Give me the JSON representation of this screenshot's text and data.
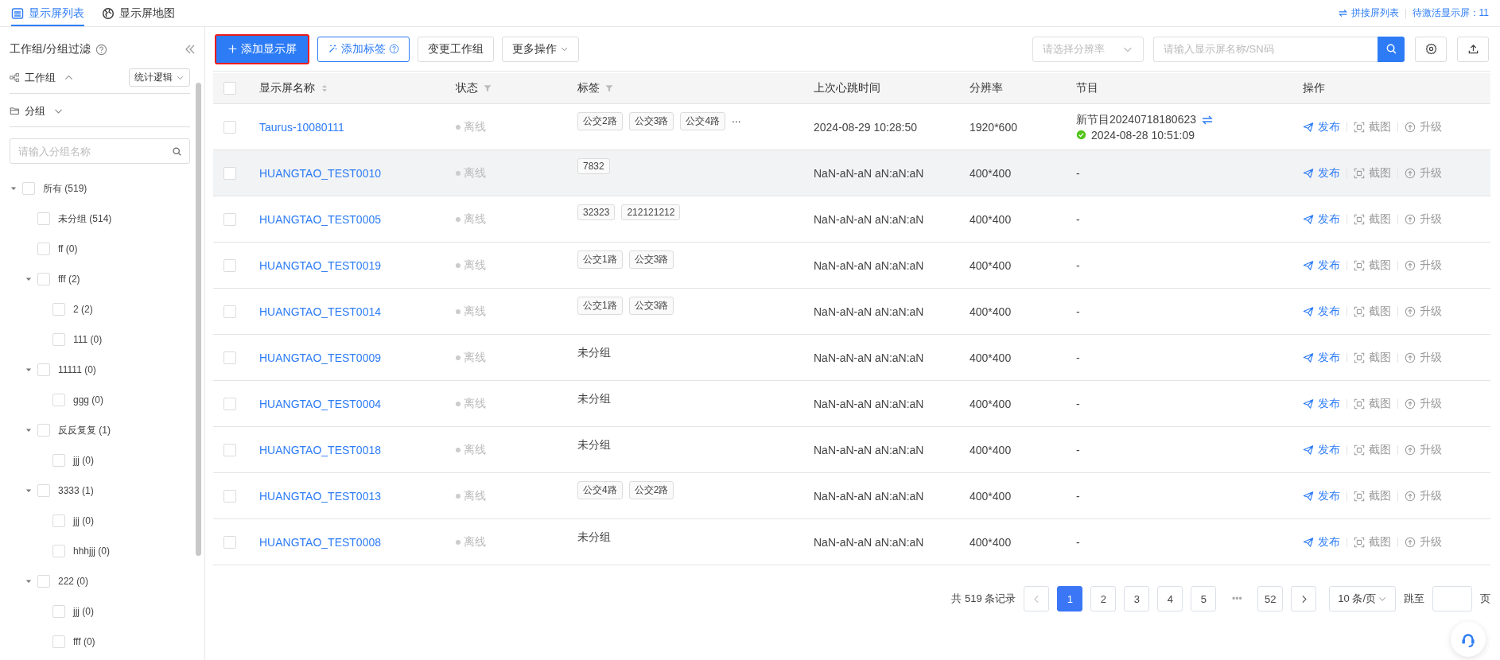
{
  "top_tabs": [
    {
      "label": "显示屏列表",
      "selected": true
    },
    {
      "label": "显示屏地图",
      "selected": false
    }
  ],
  "top_links": {
    "splice": "拼接屏列表",
    "pending": "待激活显示屏：11"
  },
  "sidebar": {
    "title": "工作组/分组过滤",
    "workgroup": {
      "label": "工作组",
      "expanded": true,
      "logic": "统计逻辑"
    },
    "group": {
      "label": "分组",
      "expanded": false
    },
    "search": {
      "placeholder": "请输入分组名称"
    },
    "tree": [
      {
        "label": "所有 (519)",
        "checked": false,
        "expanded": true,
        "children": [
          {
            "label": "未分组 (514)",
            "checked": false
          },
          {
            "label": "ff (0)",
            "checked": false
          },
          {
            "label": "fff (2)",
            "checked": false,
            "expanded": true,
            "children": [
              {
                "label": "2 (2)",
                "checked": false
              },
              {
                "label": "111 (0)",
                "checked": false
              }
            ]
          },
          {
            "label": "11111 (0)",
            "checked": false,
            "expanded": true,
            "children": [
              {
                "label": "ggg (0)",
                "checked": false
              }
            ]
          },
          {
            "label": "反反复复 (1)",
            "checked": false,
            "expanded": true,
            "children": [
              {
                "label": "jjj (0)",
                "checked": false
              }
            ]
          },
          {
            "label": "3333 (1)",
            "checked": false,
            "expanded": true,
            "children": [
              {
                "label": "jjj (0)",
                "checked": false
              },
              {
                "label": "hhhjjj (0)",
                "checked": false
              }
            ]
          },
          {
            "label": "222 (0)",
            "checked": false,
            "expanded": true,
            "children": [
              {
                "label": "jjj (0)",
                "checked": false
              },
              {
                "label": "fff (0)",
                "checked": false
              }
            ]
          }
        ]
      }
    ]
  },
  "toolbar": {
    "buttons": [
      {
        "label": "添加显示屏",
        "kind": "primary"
      },
      {
        "label": "添加标签",
        "kind": "tag"
      },
      {
        "label": "变更工作组",
        "kind": "plain"
      },
      {
        "label": "更多操作",
        "kind": "dropdown"
      }
    ],
    "resolution": {
      "placeholder": "请选择分辨率"
    },
    "search": {
      "placeholder": "请输入显示屏名称/SN码"
    }
  },
  "table": {
    "select_all": {
      "checked": false
    },
    "columns": [
      {
        "label": "显示屏名称",
        "sort": true
      },
      {
        "label": "状态",
        "filter": true
      },
      {
        "label": "标签",
        "filter": true
      },
      {
        "label": "上次心跳时间"
      },
      {
        "label": "分辨率"
      },
      {
        "label": "节目"
      },
      {
        "label": "操作"
      }
    ],
    "rows": [
      {
        "checked": false,
        "hovered": false,
        "name": "Taurus-10080111",
        "status": {
          "label": "离线",
          "kind": "offline"
        },
        "tags": {
          "kind": "tags",
          "items": [
            "公交2路",
            "公交3路",
            "公交4路"
          ],
          "more": "..."
        },
        "heartbeat": "2024-08-29 10:28:50",
        "resolution": "1920*600",
        "program": {
          "kind": "program",
          "name": "新节目20240718180623",
          "time": "2024-08-28 10:51:09"
        },
        "actions": [
          {
            "label": "发布",
            "disabled": false
          },
          {
            "label": "截图",
            "disabled": true
          },
          {
            "label": "升级",
            "disabled": true
          }
        ]
      },
      {
        "checked": false,
        "hovered": true,
        "name": "HUANGTAO_TEST0010",
        "status": {
          "label": "离线",
          "kind": "offline"
        },
        "tags": {
          "kind": "tags",
          "items": [
            "7832"
          ]
        },
        "heartbeat": "NaN-aN-aN aN:aN:aN",
        "resolution": "400*400",
        "program": {
          "kind": "text",
          "text": "-"
        },
        "actions": [
          {
            "label": "发布",
            "disabled": false
          },
          {
            "label": "截图",
            "disabled": true
          },
          {
            "label": "升级",
            "disabled": true
          }
        ]
      },
      {
        "checked": false,
        "hovered": false,
        "name": "HUANGTAO_TEST0005",
        "status": {
          "label": "离线",
          "kind": "offline"
        },
        "tags": {
          "kind": "tags",
          "items": [
            "32323",
            "212121212"
          ]
        },
        "heartbeat": "NaN-aN-aN aN:aN:aN",
        "resolution": "400*400",
        "program": {
          "kind": "text",
          "text": "-"
        },
        "actions": [
          {
            "label": "发布",
            "disabled": false
          },
          {
            "label": "截图",
            "disabled": true
          },
          {
            "label": "升级",
            "disabled": true
          }
        ]
      },
      {
        "checked": false,
        "hovered": false,
        "name": "HUANGTAO_TEST0019",
        "status": {
          "label": "离线",
          "kind": "offline"
        },
        "tags": {
          "kind": "tags",
          "items": [
            "公交1路",
            "公交3路"
          ]
        },
        "heartbeat": "NaN-aN-aN aN:aN:aN",
        "resolution": "400*400",
        "program": {
          "kind": "text",
          "text": "-"
        },
        "actions": [
          {
            "label": "发布",
            "disabled": false
          },
          {
            "label": "截图",
            "disabled": true
          },
          {
            "label": "升级",
            "disabled": true
          }
        ]
      },
      {
        "checked": false,
        "hovered": false,
        "name": "HUANGTAO_TEST0014",
        "status": {
          "label": "离线",
          "kind": "offline"
        },
        "tags": {
          "kind": "tags",
          "items": [
            "公交1路",
            "公交3路"
          ]
        },
        "heartbeat": "NaN-aN-aN aN:aN:aN",
        "resolution": "400*400",
        "program": {
          "kind": "text",
          "text": "-"
        },
        "actions": [
          {
            "label": "发布",
            "disabled": false
          },
          {
            "label": "截图",
            "disabled": true
          },
          {
            "label": "升级",
            "disabled": true
          }
        ]
      },
      {
        "checked": false,
        "hovered": false,
        "name": "HUANGTAO_TEST0009",
        "status": {
          "label": "离线",
          "kind": "offline"
        },
        "tags": {
          "kind": "text",
          "text": "未分组"
        },
        "heartbeat": "NaN-aN-aN aN:aN:aN",
        "resolution": "400*400",
        "program": {
          "kind": "text",
          "text": "-"
        },
        "actions": [
          {
            "label": "发布",
            "disabled": false
          },
          {
            "label": "截图",
            "disabled": true
          },
          {
            "label": "升级",
            "disabled": true
          }
        ]
      },
      {
        "checked": false,
        "hovered": false,
        "name": "HUANGTAO_TEST0004",
        "status": {
          "label": "离线",
          "kind": "offline"
        },
        "tags": {
          "kind": "text",
          "text": "未分组"
        },
        "heartbeat": "NaN-aN-aN aN:aN:aN",
        "resolution": "400*400",
        "program": {
          "kind": "text",
          "text": "-"
        },
        "actions": [
          {
            "label": "发布",
            "disabled": false
          },
          {
            "label": "截图",
            "disabled": true
          },
          {
            "label": "升级",
            "disabled": true
          }
        ]
      },
      {
        "checked": false,
        "hovered": false,
        "name": "HUANGTAO_TEST0018",
        "status": {
          "label": "离线",
          "kind": "offline"
        },
        "tags": {
          "kind": "text",
          "text": "未分组"
        },
        "heartbeat": "NaN-aN-aN aN:aN:aN",
        "resolution": "400*400",
        "program": {
          "kind": "text",
          "text": "-"
        },
        "actions": [
          {
            "label": "发布",
            "disabled": false
          },
          {
            "label": "截图",
            "disabled": true
          },
          {
            "label": "升级",
            "disabled": true
          }
        ]
      },
      {
        "checked": false,
        "hovered": false,
        "name": "HUANGTAO_TEST0013",
        "status": {
          "label": "离线",
          "kind": "offline"
        },
        "tags": {
          "kind": "tags",
          "items": [
            "公交4路",
            "公交2路"
          ]
        },
        "heartbeat": "NaN-aN-aN aN:aN:aN",
        "resolution": "400*400",
        "program": {
          "kind": "text",
          "text": "-"
        },
        "actions": [
          {
            "label": "发布",
            "disabled": false
          },
          {
            "label": "截图",
            "disabled": true
          },
          {
            "label": "升级",
            "disabled": true
          }
        ]
      },
      {
        "checked": false,
        "hovered": false,
        "name": "HUANGTAO_TEST0008",
        "status": {
          "label": "离线",
          "kind": "offline"
        },
        "tags": {
          "kind": "text",
          "text": "未分组"
        },
        "heartbeat": "NaN-aN-aN aN:aN:aN",
        "resolution": "400*400",
        "program": {
          "kind": "text",
          "text": "-"
        },
        "actions": [
          {
            "label": "发布",
            "disabled": false
          },
          {
            "label": "截图",
            "disabled": true
          },
          {
            "label": "升级",
            "disabled": true
          }
        ]
      }
    ]
  },
  "pagination": {
    "total": "共 519 条记录",
    "pages": [
      {
        "label": "1",
        "selected": true
      },
      {
        "label": "2",
        "selected": false
      },
      {
        "label": "3",
        "selected": false
      },
      {
        "label": "4",
        "selected": false
      },
      {
        "label": "5",
        "selected": false
      },
      {
        "label": "•••",
        "kind": "ellipsis"
      },
      {
        "label": "52",
        "selected": false
      }
    ],
    "page_size": "10 条/页",
    "jump_label": "跳至",
    "page_suffix": "页"
  }
}
